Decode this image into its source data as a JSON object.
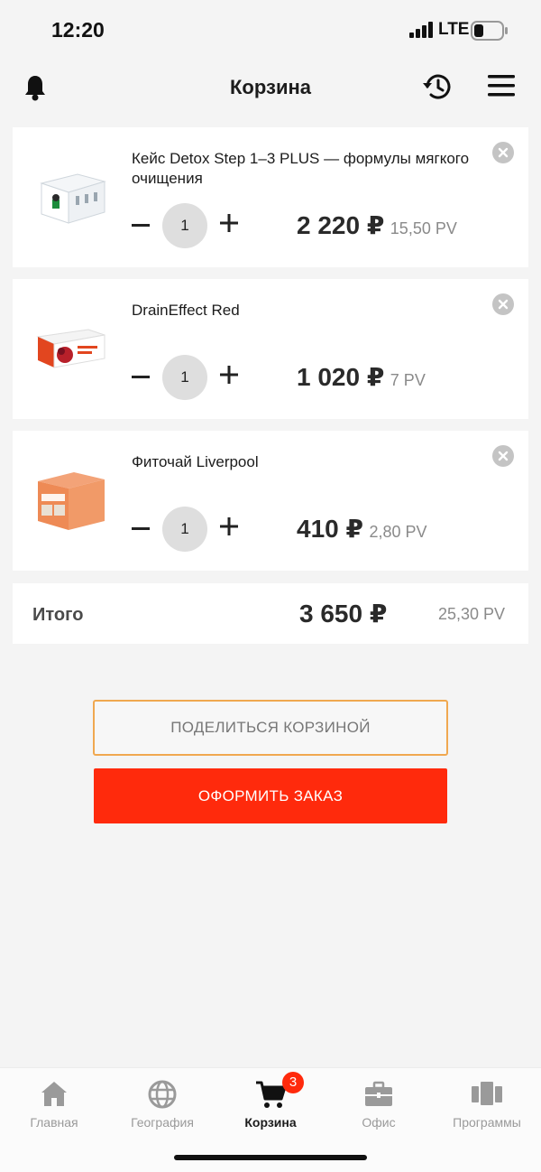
{
  "status_bar": {
    "time": "12:20",
    "network": "LTE"
  },
  "header": {
    "title": "Корзина"
  },
  "cart_items": [
    {
      "name": "Кейс Detox Step 1–3 PLUS — формулы мягкого очищения",
      "quantity": "1",
      "price": "2 220 ₽",
      "pv": "15,50 PV",
      "icon": "detox-box-product-icon"
    },
    {
      "name": "DrainEffect Red",
      "quantity": "1",
      "price": "1 020 ₽",
      "pv": "7 PV",
      "icon": "draineffect-box-product-icon"
    },
    {
      "name": "Фиточай Liverpool",
      "quantity": "1",
      "price": "410 ₽",
      "pv": "2,80 PV",
      "icon": "liverpool-tea-product-icon"
    }
  ],
  "total": {
    "label": "Итого",
    "price": "3 650 ₽",
    "pv": "25,30 PV"
  },
  "actions": {
    "share_label": "ПОДЕЛИТЬСЯ КОРЗИНОЙ",
    "order_label": "ОФОРМИТЬ ЗАКАЗ"
  },
  "tabs": [
    {
      "label": "Главная",
      "icon": "home-icon",
      "active": false
    },
    {
      "label": "География",
      "icon": "globe-icon",
      "active": false
    },
    {
      "label": "Корзина",
      "icon": "cart-icon",
      "active": true,
      "badge": "3"
    },
    {
      "label": "Офис",
      "icon": "briefcase-icon",
      "active": false
    },
    {
      "label": "Программы",
      "icon": "programs-icon",
      "active": false
    }
  ],
  "colors": {
    "accent": "#ff2a0c",
    "share_border": "#f0a850",
    "background": "#f4f4f4",
    "muted_text": "#8a8a8a"
  }
}
